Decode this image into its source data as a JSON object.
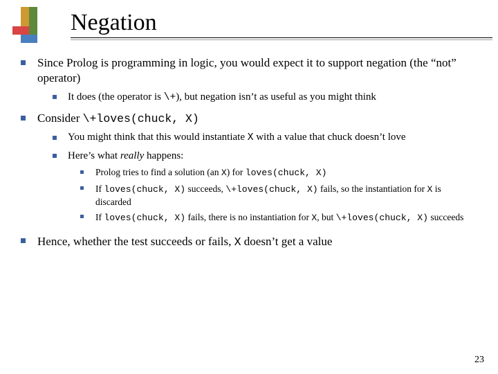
{
  "title": "Negation",
  "page_number": "23",
  "b1": {
    "text_a": "Since Prolog is programming in logic, you would expect it to support negation (the “not” operator)",
    "sub1_a": "It does (the operator is ",
    "sub1_code": "\\+",
    "sub1_b": "), but negation isn’t as useful as you might think"
  },
  "b2": {
    "text_a": "Consider ",
    "code": "\\+loves(chuck, X)",
    "sub1_a": "You might think that this would instantiate ",
    "sub1_code": "X",
    "sub1_b": " with a value that chuck doesn’t love",
    "sub2_a": "Here’s what ",
    "sub2_em": "really",
    "sub2_b": " happens:",
    "l3_1_a": "Prolog tries to find a solution (an ",
    "l3_1_code1": "X",
    "l3_1_b": ") for ",
    "l3_1_code2": "loves(chuck, X)",
    "l3_2_a": "If ",
    "l3_2_code1": "loves(chuck, X)",
    "l3_2_b": " succeeds, ",
    "l3_2_code2": "\\+loves(chuck, X)",
    "l3_2_c": " fails, so the instantiation for ",
    "l3_2_code3": "X",
    "l3_2_d": " is discarded",
    "l3_3_a": "If ",
    "l3_3_code1": "loves(chuck, X)",
    "l3_3_b": " fails, there is no instantiation for ",
    "l3_3_code2": "X",
    "l3_3_c": ", but ",
    "l3_3_code3": "\\+loves(chuck, X)",
    "l3_3_d": " succeeds"
  },
  "b3": {
    "text_a": "Hence, whether the test succeeds or fails, ",
    "code": "X",
    "text_b": " doesn’t get a value"
  }
}
